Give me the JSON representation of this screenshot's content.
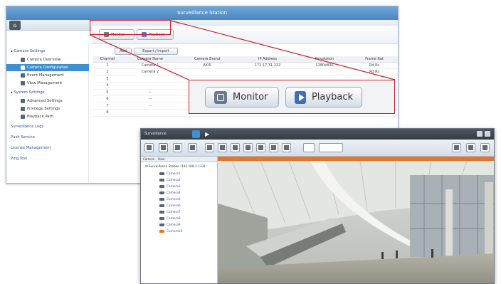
{
  "surveillance": {
    "window_title": "Surveillance Station",
    "home_icon": "home-icon",
    "top_buttons": [
      {
        "label": "Monitor",
        "icon": "monitor-icon"
      },
      {
        "label": "Playback",
        "icon": "playback-icon"
      }
    ],
    "sidebar": {
      "groups": [
        {
          "label": "Camera Settings",
          "items": [
            "Camera Overview",
            "Camera Configuration",
            "Event Management",
            "View Management"
          ]
        },
        {
          "label": "System Settings",
          "items": [
            "Advanced Settings",
            "Privilege Settings",
            "Playback Path"
          ]
        }
      ],
      "active_item": "Camera Configuration",
      "bottom_items": [
        "Surveillance Logs",
        "Push Service",
        "License Management",
        "Ping Test"
      ]
    },
    "main": {
      "buttons": [
        "Add",
        "Export / Import"
      ],
      "columns": [
        "Channel",
        "Camera Name",
        "Camera Brand",
        "IP Address",
        "Resolution",
        "Frame Rat"
      ],
      "rows": [
        [
          "1",
          "Camera 1",
          "AXIS",
          "172.17.31.222",
          "1280x800",
          "Rd Rs"
        ],
        [
          "2",
          "Camera 2",
          "",
          "",
          "",
          "Rd Rs"
        ],
        [
          "3",
          "",
          "",
          "",
          "",
          ""
        ],
        [
          "4",
          "",
          "",
          "",
          "",
          ""
        ],
        [
          "5",
          "--",
          "--",
          "--",
          "--",
          "--"
        ],
        [
          "6",
          "--",
          "--",
          "--",
          "--",
          "--"
        ],
        [
          "7",
          "--",
          "--",
          "--",
          "--",
          "--"
        ],
        [
          "8",
          "",
          "",
          "",
          "",
          ""
        ]
      ]
    }
  },
  "callout": {
    "buttons": [
      {
        "label": "Monitor",
        "icon": "monitor-icon"
      },
      {
        "label": "Playback",
        "icon": "playback-icon"
      }
    ]
  },
  "monitor_window": {
    "title": "Surveillance",
    "toolbar_icons": [
      "grid-1x1-icon",
      "grid-2x2-icon",
      "grid-3x3-icon",
      "layout-icon",
      "layout-icon",
      "layout-icon",
      "layout-icon",
      "layout-icon",
      "layout-icon",
      "layout-icon",
      "layout-icon",
      "sequence-icon"
    ],
    "zoom_label": "",
    "tree_tabs": [
      "Camera",
      "View"
    ],
    "tree_root": "Surveillance Station (192.168.1.123)",
    "cameras": [
      "Camera1",
      "Camera2",
      "Camera3",
      "Camera4",
      "Camera5",
      "Camera6",
      "Camera7",
      "Camera8",
      "Camera9",
      "Camera10"
    ],
    "colors": {
      "accent": "#e5742d",
      "titlebar": "#3d8fd6"
    }
  }
}
